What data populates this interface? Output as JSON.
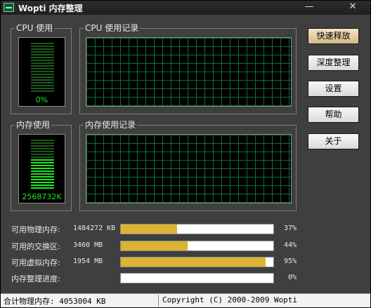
{
  "window": {
    "title": "Wopti 内存整理",
    "minimize": "—",
    "close": "✕"
  },
  "panels": {
    "cpu_usage": {
      "label": "CPU 使用",
      "value": "0%"
    },
    "cpu_history": {
      "label": "CPU 使用记录"
    },
    "mem_usage": {
      "label": "内存使用",
      "value": "2568732K"
    },
    "mem_history": {
      "label": "内存使用记录"
    }
  },
  "buttons": [
    "快速释放",
    "深度整理",
    "设置",
    "帮助",
    "关于"
  ],
  "stats": [
    {
      "label": "可用物理内存:",
      "value": "1484272 KB",
      "percent": "37%",
      "fill": 37
    },
    {
      "label": "可用的交换区:",
      "value": "3460 MB",
      "percent": "44%",
      "fill": 44
    },
    {
      "label": "可用虚拟内存:",
      "value": "1954 MB",
      "percent": "95%",
      "fill": 95
    },
    {
      "label": "内存整理进度:",
      "value": "",
      "percent": "0%",
      "fill": 0
    }
  ],
  "status": {
    "left": "合计物理内存: 4053004 KB",
    "right": "Copyright (C) 2000-2009 Wopti"
  },
  "colors": {
    "accent_fill": "#ddb432",
    "meter_on": "#1ee51e",
    "meter_off": "#1a5a1a",
    "grid": "#0e6f35"
  }
}
